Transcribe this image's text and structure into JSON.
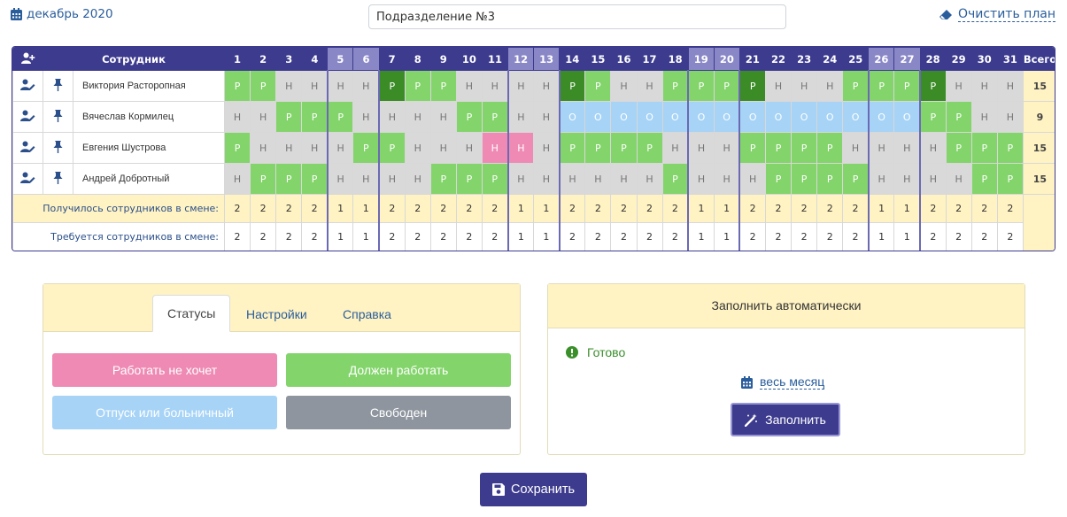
{
  "header": {
    "month_label": "декабрь 2020",
    "department_value": "Подразделение №3",
    "clear_plan_label": "Очистить план"
  },
  "schedule": {
    "employee_header": "Сотрудник",
    "total_header": "Всего",
    "days": [
      "1",
      "2",
      "3",
      "4",
      "5",
      "6",
      "7",
      "8",
      "9",
      "10",
      "11",
      "12",
      "13",
      "14",
      "15",
      "16",
      "17",
      "18",
      "19",
      "20",
      "21",
      "22",
      "23",
      "24",
      "25",
      "26",
      "27",
      "28",
      "29",
      "30",
      "31"
    ],
    "weekend_days": [
      5,
      6,
      12,
      13,
      19,
      20,
      26,
      27
    ],
    "employees": [
      {
        "name": "Виктория Расторопная",
        "total": "15",
        "cells": [
          "P",
          "P",
          "H",
          "H",
          "H",
          "H",
          "PD",
          "P",
          "P",
          "H",
          "H",
          "H",
          "H",
          "PD",
          "P",
          "H",
          "H",
          "P",
          "P",
          "P",
          "PD",
          "H",
          "H",
          "H",
          "P",
          "P",
          "P",
          "PD",
          "H",
          "H",
          "H"
        ]
      },
      {
        "name": "Вячеслав Кормилец",
        "total": "9",
        "cells": [
          "H",
          "H",
          "P",
          "P",
          "P",
          "H",
          "H",
          "H",
          "H",
          "P",
          "P",
          "H",
          "H",
          "O",
          "O",
          "O",
          "O",
          "O",
          "O",
          "O",
          "O",
          "O",
          "O",
          "O",
          "O",
          "O",
          "O",
          "P",
          "P",
          "H",
          "H"
        ]
      },
      {
        "name": "Евгения Шустрова",
        "total": "15",
        "cells": [
          "P",
          "H",
          "H",
          "H",
          "H",
          "P",
          "P",
          "H",
          "H",
          "H",
          "NP",
          "NP",
          "H",
          "P",
          "P",
          "P",
          "P",
          "H",
          "H",
          "H",
          "P",
          "P",
          "P",
          "P",
          "H",
          "H",
          "H",
          "H",
          "P",
          "P",
          "P"
        ]
      },
      {
        "name": "Андрей Добротный",
        "total": "15",
        "cells": [
          "H",
          "P",
          "P",
          "P",
          "H",
          "H",
          "H",
          "H",
          "P",
          "P",
          "P",
          "H",
          "H",
          "H",
          "H",
          "H",
          "H",
          "P",
          "H",
          "H",
          "H",
          "P",
          "P",
          "P",
          "P",
          "H",
          "H",
          "H",
          "H",
          "P",
          "P"
        ]
      }
    ],
    "cell_labels": {
      "P": "Р",
      "PD": "Р",
      "H": "Н",
      "O": "О",
      "NP": "Н"
    },
    "got_label": "Получилось сотрудников в смене:",
    "got_values": [
      "2",
      "2",
      "2",
      "2",
      "1",
      "1",
      "2",
      "2",
      "2",
      "2",
      "2",
      "1",
      "1",
      "2",
      "2",
      "2",
      "2",
      "2",
      "1",
      "1",
      "2",
      "2",
      "2",
      "2",
      "2",
      "1",
      "1",
      "2",
      "2",
      "2",
      "2"
    ],
    "required_label": "Требуется сотрудников в смене:",
    "required_values": [
      "2",
      "2",
      "2",
      "2",
      "1",
      "1",
      "2",
      "2",
      "2",
      "2",
      "2",
      "1",
      "1",
      "2",
      "2",
      "2",
      "2",
      "2",
      "1",
      "1",
      "2",
      "2",
      "2",
      "2",
      "2",
      "1",
      "1",
      "2",
      "2",
      "2",
      "2"
    ]
  },
  "status_panel": {
    "tabs": [
      {
        "label": "Статусы",
        "active": true
      },
      {
        "label": "Настройки",
        "active": false
      },
      {
        "label": "Справка",
        "active": false
      }
    ],
    "buttons": {
      "wont_work": "Работать не хочет",
      "must_work": "Должен работать",
      "vacation": "Отпуск или больничный",
      "free": "Свободен"
    },
    "colors": {
      "wont_work": "#ee8ab4",
      "must_work": "#83d46b",
      "vacation": "#a6d3f6",
      "free": "#8e959e"
    }
  },
  "auto_panel": {
    "title": "Заполнить автоматически",
    "status_text": "Готово",
    "period_label": "весь месяц",
    "fill_button": "Заполнить"
  },
  "footer": {
    "save_button": "Сохранить"
  }
}
